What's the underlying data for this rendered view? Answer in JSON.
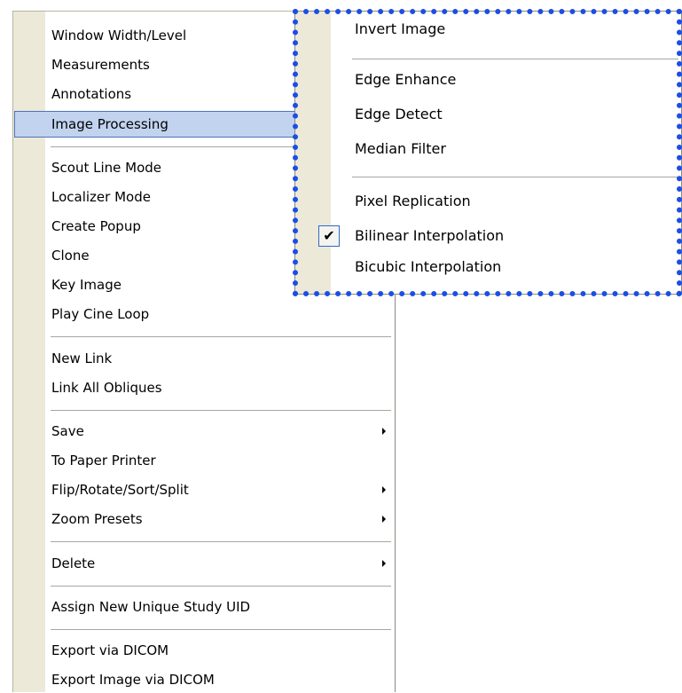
{
  "main_menu": {
    "items": [
      {
        "label": "Window Width/Level"
      },
      {
        "label": "Measurements"
      },
      {
        "label": "Annotations"
      },
      {
        "label": "Image Processing",
        "highlighted": true
      },
      {
        "label": "Scout Line Mode"
      },
      {
        "label": "Localizer Mode"
      },
      {
        "label": "Create Popup"
      },
      {
        "label": "Clone"
      },
      {
        "label": "Key Image"
      },
      {
        "label": "Play Cine Loop"
      },
      {
        "label": "New Link"
      },
      {
        "label": "Link All Obliques"
      },
      {
        "label": "Save",
        "submenu": true
      },
      {
        "label": "To Paper Printer"
      },
      {
        "label": "Flip/Rotate/Sort/Split",
        "submenu": true
      },
      {
        "label": "Zoom Presets",
        "submenu": true
      },
      {
        "label": "Delete",
        "submenu": true
      },
      {
        "label": "Assign New Unique Study UID"
      },
      {
        "label": "Export via DICOM"
      },
      {
        "label": "Export Image via DICOM"
      }
    ]
  },
  "sub_menu": {
    "items": [
      {
        "label": "Invert Image"
      },
      {
        "label": "Edge Enhance"
      },
      {
        "label": "Edge Detect"
      },
      {
        "label": "Median Filter"
      },
      {
        "label": "Pixel Replication"
      },
      {
        "label": "Bilinear Interpolation",
        "checked": true
      },
      {
        "label": "Bicubic Interpolation"
      }
    ]
  },
  "colors": {
    "gutter": "#ece9d8",
    "highlight": "#c2d3ef",
    "highlight_border": "#4c74b8",
    "dotted_outline": "#1a4ee8"
  },
  "icons": {
    "submenu_arrow": "arrow-right-icon",
    "checkmark": "checkmark-icon"
  }
}
